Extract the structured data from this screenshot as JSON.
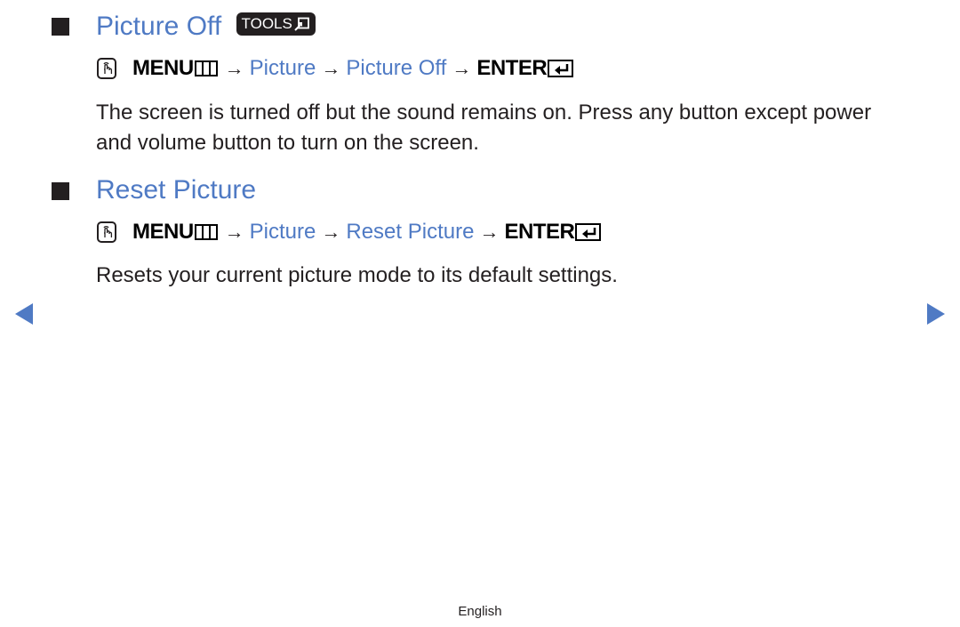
{
  "sections": [
    {
      "heading": "Picture Off",
      "tools_badge": "TOOLS",
      "menu_path": {
        "menu_key": "MENU",
        "steps": [
          "Picture",
          "Picture Off"
        ],
        "enter_key": "ENTER"
      },
      "description": "The screen is turned off but the sound remains on. Press any button except power and volume button to turn on the screen."
    },
    {
      "heading": "Reset Picture",
      "menu_path": {
        "menu_key": "MENU",
        "steps": [
          "Picture",
          "Reset Picture"
        ],
        "enter_key": "ENTER"
      },
      "description": "Resets your current picture mode to its default settings."
    }
  ],
  "arrow_glyph": "→",
  "navigation": {
    "prev_icon": "triangle-left",
    "next_icon": "triangle-right"
  },
  "footer": {
    "language": "English"
  },
  "colors": {
    "accent": "#4f7ac4",
    "text": "#231f20"
  }
}
